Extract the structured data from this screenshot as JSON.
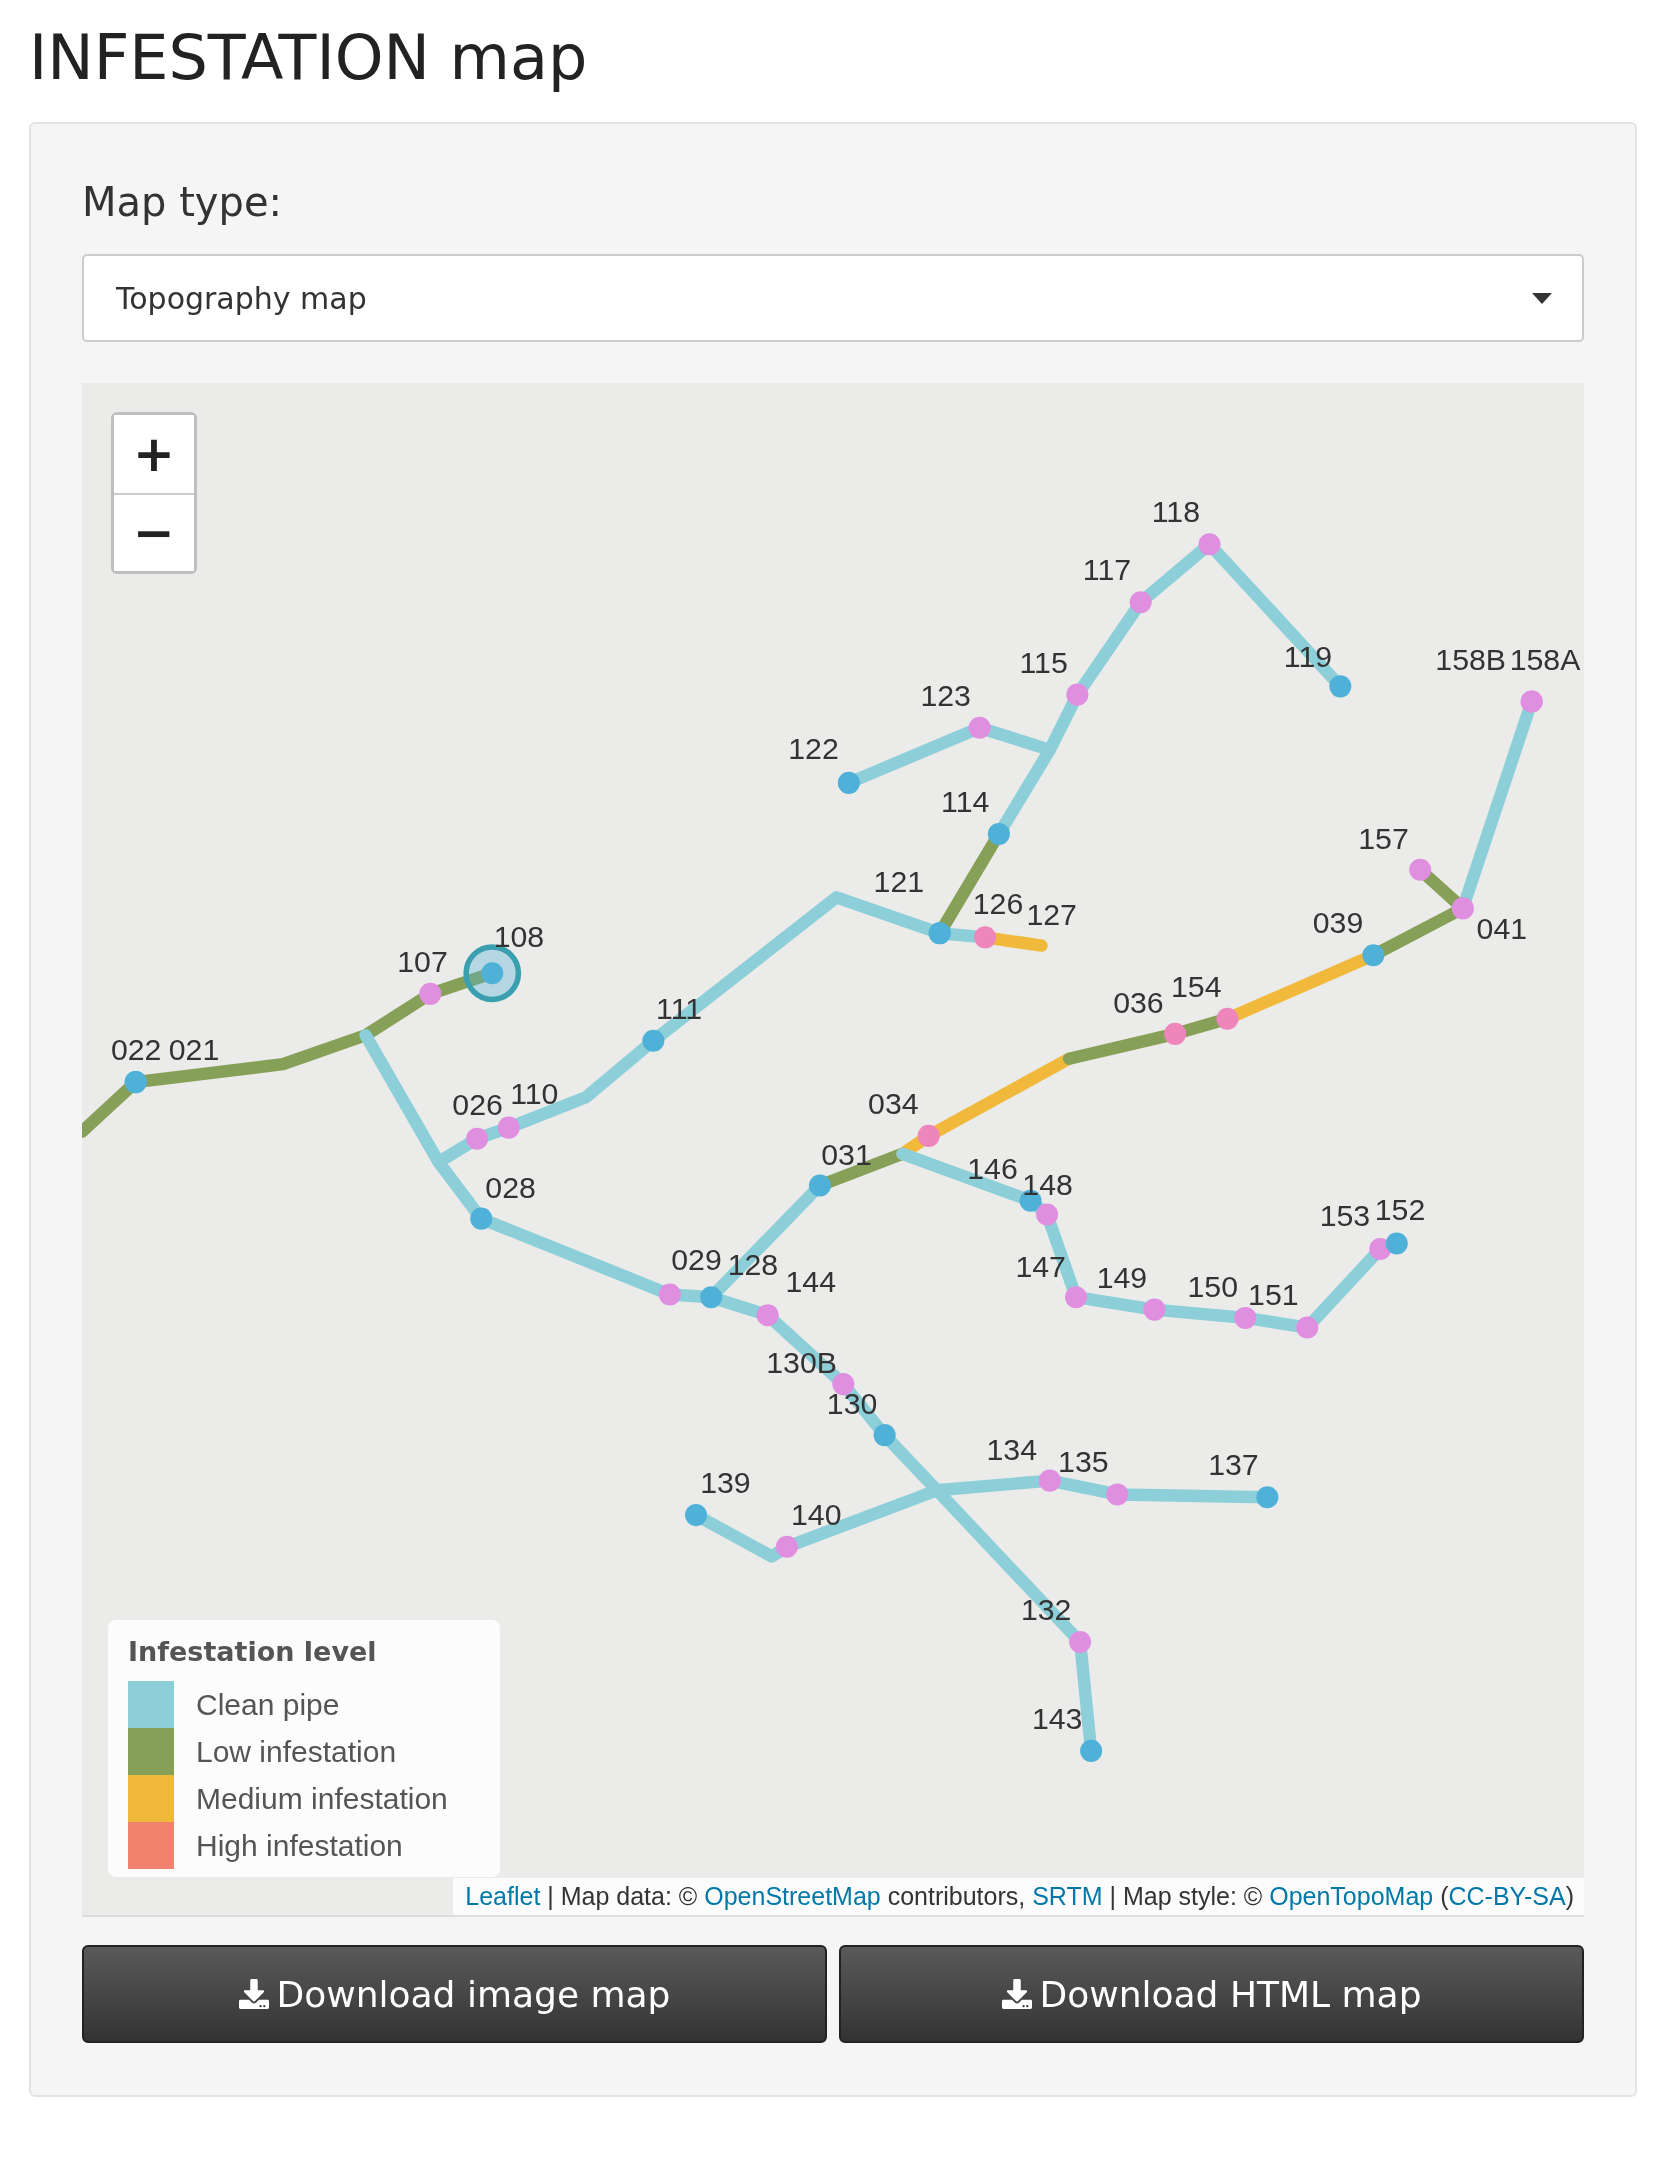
{
  "title": "INFESTATION map",
  "map_type": {
    "label": "Map type:",
    "value": "Topography map"
  },
  "map": {
    "zoom_controls": [
      "+",
      "−"
    ],
    "pipes": [
      {
        "kind": "low"
      },
      {
        "kind": "clean"
      },
      {
        "kind": "clean"
      },
      {
        "kind": "medium"
      },
      {
        "kind": "low"
      },
      {
        "kind": "clean"
      },
      {
        "kind": "clean"
      },
      {
        "kind": "clean"
      },
      {
        "kind": "low"
      },
      {
        "kind": "medium"
      },
      {
        "kind": "low"
      },
      {
        "kind": "medium"
      },
      {
        "kind": "low"
      },
      {
        "kind": "clean"
      },
      {
        "kind": "clean"
      },
      {
        "kind": "clean"
      }
    ],
    "nodes": [
      {
        "label": "022",
        "color": "#4fb1d8",
        "highlighted": false
      },
      {
        "label": "021",
        "color": "#4fb1d8",
        "highlighted": false
      },
      {
        "label": "107",
        "color": "#e08ee0",
        "highlighted": false
      },
      {
        "label": "108",
        "color": "#4fb1d8",
        "highlighted": true
      },
      {
        "label": "026",
        "color": "#e08ee0",
        "highlighted": false
      },
      {
        "label": "110",
        "color": "#e08ee0",
        "highlighted": false
      },
      {
        "label": "111",
        "color": "#4fb1d8",
        "highlighted": false
      },
      {
        "label": "028",
        "color": "#4fb1d8",
        "highlighted": false
      },
      {
        "label": "029",
        "color": "#e08ee0",
        "highlighted": false
      },
      {
        "label": "128",
        "color": "#4fb1d8",
        "highlighted": false
      },
      {
        "label": "144",
        "color": "#e08ee0",
        "highlighted": false
      },
      {
        "label": "130B",
        "color": "#e08ee0",
        "highlighted": false
      },
      {
        "label": "130",
        "color": "#4fb1d8",
        "highlighted": false
      },
      {
        "label": "031",
        "color": "#4fb1d8",
        "highlighted": false
      },
      {
        "label": "034",
        "color": "#ee86bc",
        "highlighted": false
      },
      {
        "label": "036",
        "color": "#ee86bc",
        "highlighted": false
      },
      {
        "label": "154",
        "color": "#ee86bc",
        "highlighted": false
      },
      {
        "label": "039",
        "color": "#4fb1d8",
        "highlighted": false
      },
      {
        "label": "041",
        "color": "#e08ee0",
        "highlighted": false
      },
      {
        "label": "157",
        "color": "#e08ee0",
        "highlighted": false
      },
      {
        "label": "119",
        "color": "#4fb1d8",
        "highlighted": false
      },
      {
        "label": "158B",
        "color": "#e08ee0",
        "highlighted": false
      },
      {
        "label": "158A",
        "color": "#e08ee0",
        "highlighted": false
      },
      {
        "label": "118",
        "color": "#e08ee0",
        "highlighted": false
      },
      {
        "label": "117",
        "color": "#e08ee0",
        "highlighted": false
      },
      {
        "label": "115",
        "color": "#e08ee0",
        "highlighted": false
      },
      {
        "label": "123",
        "color": "#e08ee0",
        "highlighted": false
      },
      {
        "label": "122",
        "color": "#4fb1d8",
        "highlighted": false
      },
      {
        "label": "114",
        "color": "#4fb1d8",
        "highlighted": false
      },
      {
        "label": "121",
        "color": "#4fb1d8",
        "highlighted": false
      },
      {
        "label": "126",
        "color": "#4fb1d8",
        "highlighted": false
      },
      {
        "label": "127",
        "color": "#ee86bc",
        "highlighted": false
      },
      {
        "label": "146",
        "color": "#4fb1d8",
        "highlighted": false
      },
      {
        "label": "148",
        "color": "#e08ee0",
        "highlighted": false
      },
      {
        "label": "147",
        "color": "#e08ee0",
        "highlighted": false
      },
      {
        "label": "149",
        "color": "#e08ee0",
        "highlighted": false
      },
      {
        "label": "150",
        "color": "#e08ee0",
        "highlighted": false
      },
      {
        "label": "151",
        "color": "#e08ee0",
        "highlighted": false
      },
      {
        "label": "153",
        "color": "#e08ee0",
        "highlighted": false
      },
      {
        "label": "152",
        "color": "#4fb1d8",
        "highlighted": false
      },
      {
        "label": "134",
        "color": "#e08ee0",
        "highlighted": false
      },
      {
        "label": "135",
        "color": "#e08ee0",
        "highlighted": false
      },
      {
        "label": "137",
        "color": "#4fb1d8",
        "highlighted": false
      },
      {
        "label": "139",
        "color": "#4fb1d8",
        "highlighted": false
      },
      {
        "label": "140",
        "color": "#e08ee0",
        "highlighted": false
      },
      {
        "label": "132",
        "color": "#e08ee0",
        "highlighted": false
      },
      {
        "label": "143",
        "color": "#4fb1d8",
        "highlighted": false
      }
    ],
    "legend": {
      "title": "Infestation level",
      "items": [
        {
          "label": "Clean pipe",
          "color": "#8ccfd8"
        },
        {
          "label": "Low infestation",
          "color": "#86a058"
        },
        {
          "label": "Medium infestation",
          "color": "#f0b93c"
        },
        {
          "label": "High infestation",
          "color": "#f0826e"
        }
      ]
    },
    "attribution": [
      {
        "kind": "link",
        "text": "Leaflet"
      },
      {
        "kind": "text",
        "text": " | Map data: © "
      },
      {
        "kind": "link",
        "text": "OpenStreetMap"
      },
      {
        "kind": "text",
        "text": " contributors, "
      },
      {
        "kind": "link",
        "text": "SRTM"
      },
      {
        "kind": "text",
        "text": " | Map style: © "
      },
      {
        "kind": "link",
        "text": "OpenTopoMap"
      },
      {
        "kind": "text",
        "text": " ("
      },
      {
        "kind": "link",
        "text": "CC-BY-SA"
      },
      {
        "kind": "text",
        "text": ")"
      }
    ]
  },
  "buttons": [
    "Download image map",
    "Download HTML map"
  ]
}
